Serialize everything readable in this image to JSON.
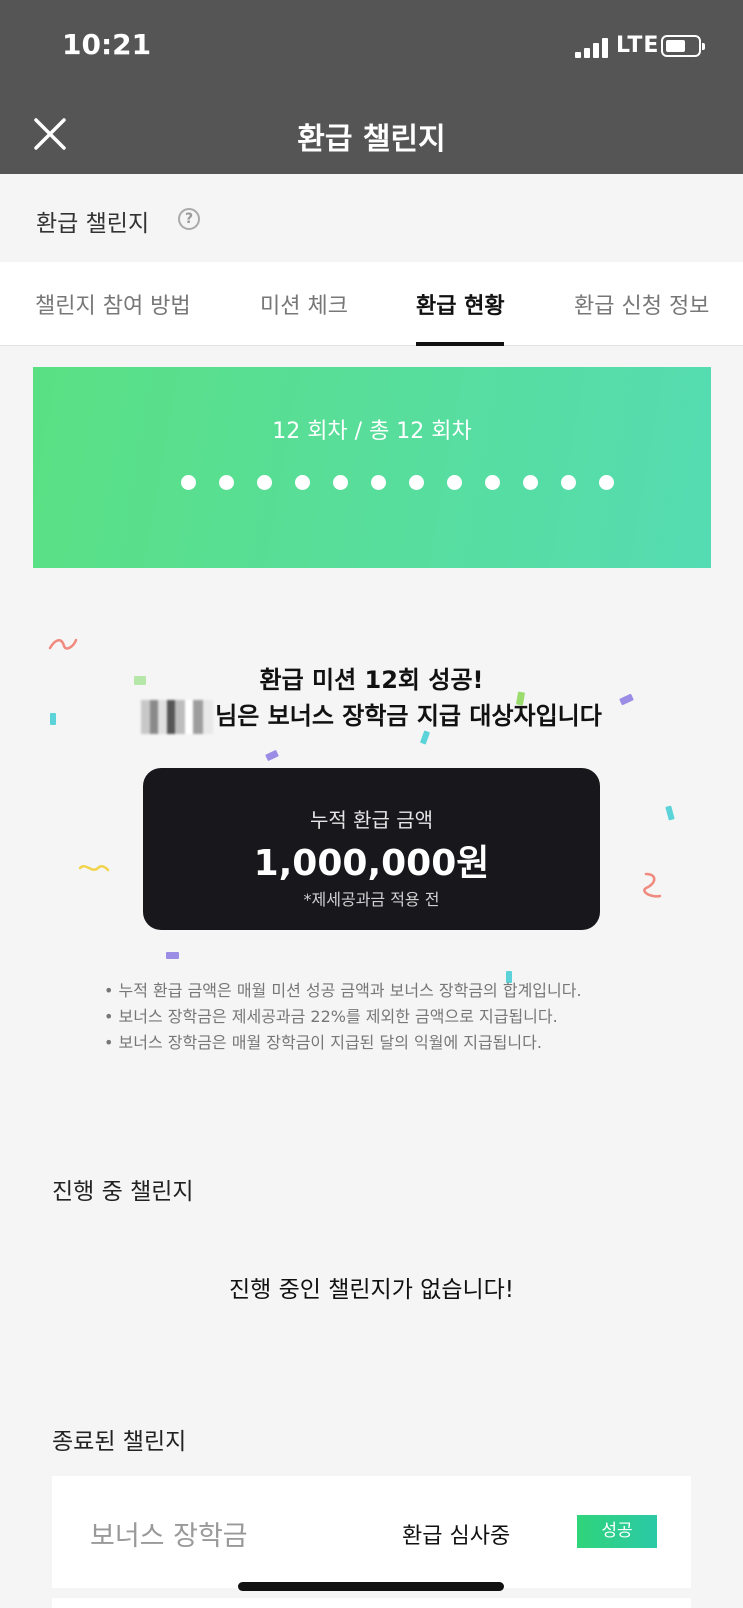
{
  "status_bar": {
    "time": "10:21",
    "network": "LTE"
  },
  "nav": {
    "title": "환급 챌린지",
    "close_icon": "close-icon"
  },
  "header": {
    "title": "환급 챌린지",
    "help_icon": "?"
  },
  "tabs": [
    {
      "label": "챌린지 참여 방법",
      "active": false
    },
    {
      "label": "미션 체크",
      "active": false
    },
    {
      "label": "환급 현황",
      "active": true
    },
    {
      "label": "환급 신청 정보",
      "active": false
    }
  ],
  "progress": {
    "text": "12 회차 / 총 12 회차",
    "completed": 12,
    "total": 12
  },
  "success": {
    "title": "환급 미션 12회 성공!",
    "subtitle": "님은 보너스 장학금 지급 대상자입니다"
  },
  "amount_card": {
    "label": "누적 환급 금액",
    "value": "1,000,000원",
    "note": "*제세공과금 적용 전"
  },
  "notes": [
    "• 누적 환급 금액은 매월 미션 성공 금액과 보너스 장학금의 합계입니다.",
    "• 보너스 장학금은 제세공과금 22%를 제외한 금액으로 지급됩니다.",
    "• 보너스 장학금은 매월 장학금이 지급된 달의 익월에 지급됩니다."
  ],
  "ongoing": {
    "title": "진행 중 챌린지",
    "empty_message": "진행 중인 챌린지가 없습니다!"
  },
  "finished": {
    "title": "종료된 챌린지",
    "items": [
      {
        "name": "보너스 장학금",
        "status": "환급 심사중",
        "badge": "성공"
      }
    ]
  },
  "colors": {
    "status_nav_bg": "#555555",
    "banner_start": "#5ae083",
    "banner_end": "#55dcb2",
    "card_bg": "#17171c",
    "badge": "#2fd47a"
  }
}
